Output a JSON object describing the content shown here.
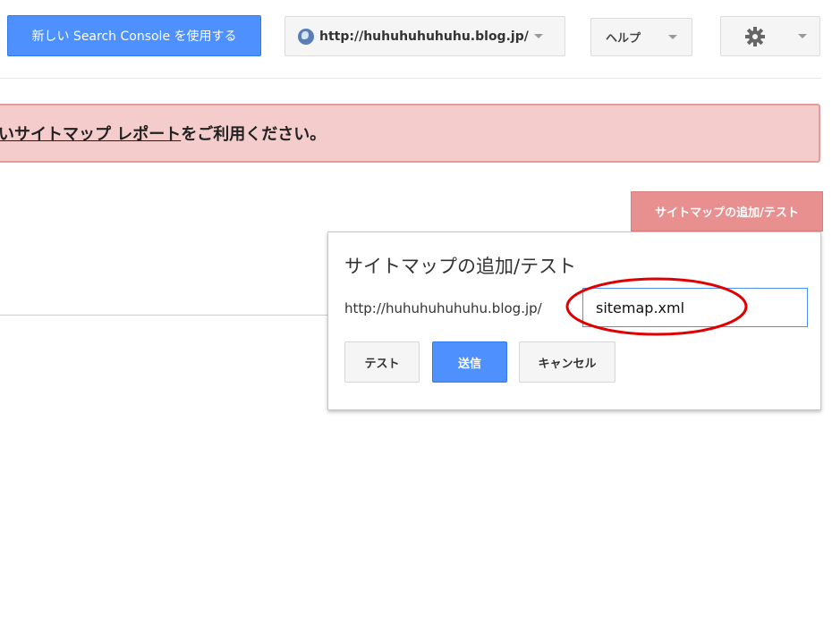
{
  "header": {
    "new_console_label": "新しい Search Console を使用する",
    "site_url": "http://huhuhuhuhuhu.blog.jp/",
    "help_label": "ヘルプ"
  },
  "banner": {
    "link_text": "いサイトマップ レポート",
    "text": "をご利用ください。"
  },
  "add_test_button_label": "サイトマップの追加/テスト",
  "popup": {
    "title": "サイトマップの追加/テスト",
    "url_prefix": "http://huhuhuhuhuhu.blog.jp/",
    "input_value": "sitemap.xml",
    "test_label": "テスト",
    "submit_label": "送信",
    "cancel_label": "キャンセル"
  },
  "colors": {
    "accent_blue": "#4d90fe",
    "banner_bg": "#f4cccc",
    "banner_border": "#e69b9b",
    "add_test_bg": "#e7908f",
    "highlight_red": "#e00000"
  },
  "icons": {
    "site": "globe-icon",
    "settings": "gear-icon",
    "dropdown": "chevron-down-icon"
  }
}
